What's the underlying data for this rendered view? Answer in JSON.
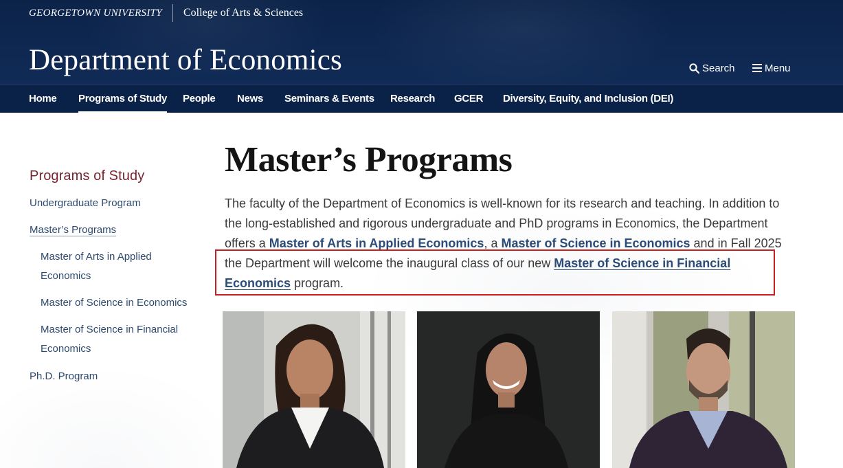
{
  "header": {
    "university": "GEORGETOWN UNIVERSITY",
    "college": "College of Arts & Sciences",
    "department": "Department of Economics",
    "search_label": "Search",
    "menu_label": "Menu"
  },
  "nav": {
    "items": [
      {
        "label": "Home"
      },
      {
        "label": "Programs of Study",
        "active": true
      },
      {
        "label": "People"
      },
      {
        "label": "News"
      },
      {
        "label": "Seminars & Events"
      },
      {
        "label": "Research"
      },
      {
        "label": "GCER"
      },
      {
        "label": "Diversity, Equity, and Inclusion (DEI)"
      }
    ]
  },
  "sidebar": {
    "heading": "Programs of Study",
    "links": [
      {
        "label": "Undergraduate Program"
      },
      {
        "label": "Master’s Programs",
        "current": true
      },
      {
        "label_line1": "Master of Arts in Applied",
        "label_line2": "Economics"
      },
      {
        "label": "Master of Science in Economics"
      },
      {
        "label_line1": "Master of Science in Financial",
        "label_line2": "Economics"
      },
      {
        "label": "Ph.D. Program"
      }
    ]
  },
  "main": {
    "title": "Master’s Programs",
    "intro": {
      "text1": "The faculty of the Department of Economics is well-known for its research and teaching. In addition to the long-established and rigorous undergraduate and PhD programs in Economics, the Department offers a ",
      "link1": "Master of Arts in Applied Economics",
      "text2": ", a ",
      "link2": "Master of Science in Economics",
      "text3": " and in Fall 2025 the Department will welcome the inaugural class of our new ",
      "link3": "Master of Science in Financial Economics",
      "text4": " program."
    }
  },
  "colors": {
    "header_bg": "#0e2751",
    "nav_bg": "#0b2248",
    "sidebar_heading": "#7a2430",
    "link": "#2b4c78",
    "highlight_border": "#c81e1e"
  },
  "icons": {
    "search": "search-icon",
    "menu": "hamburger-menu-icon"
  }
}
